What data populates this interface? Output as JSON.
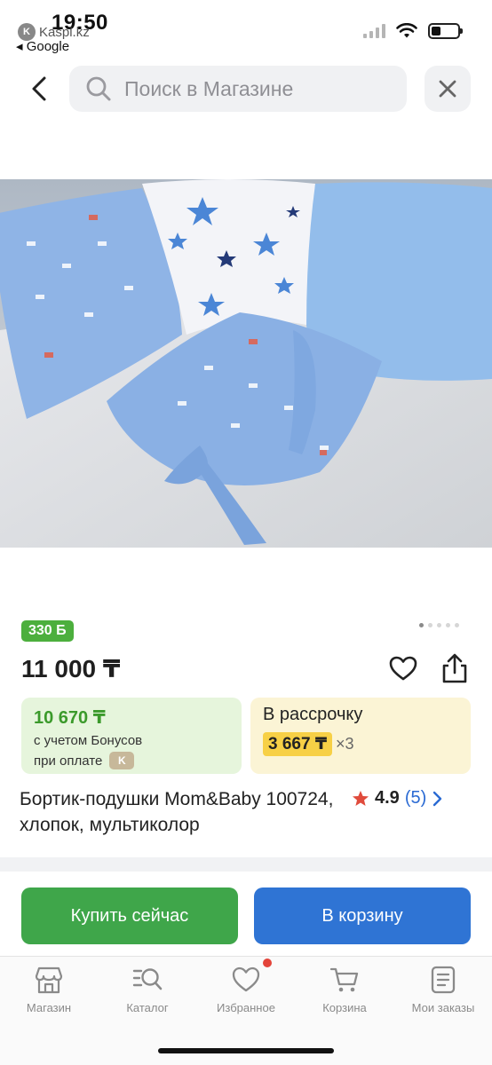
{
  "status_bar": {
    "time": "19:50",
    "source_app": "Kaspi.kz",
    "back_app": "◂ Google"
  },
  "header": {
    "search_placeholder": "Поиск в Магазине"
  },
  "product": {
    "bonus_badge": "330 Б",
    "image_index": 1,
    "image_count": 5,
    "price": "11 000 ₸",
    "bonus_card": {
      "price": "10 670 ₸",
      "line1": "с учетом Бонусов",
      "line2": "при оплате"
    },
    "installment": {
      "title": "В рассрочку",
      "amount": "3 667 ₸",
      "multiplier": "×3"
    },
    "title": "Бортик-подушки Mom&Baby 100724, хлопок, мультиколор",
    "rating": {
      "value": "4.9",
      "count": "(5)"
    }
  },
  "actions": {
    "buy_now": "Купить сейчас",
    "add_to_cart": "В корзину"
  },
  "tab_bar": {
    "items": [
      {
        "label": "Магазин",
        "icon": "store-icon"
      },
      {
        "label": "Каталог",
        "icon": "catalog-search-icon"
      },
      {
        "label": "Избранное",
        "icon": "heart-icon"
      },
      {
        "label": "Корзина",
        "icon": "cart-icon"
      },
      {
        "label": "Мои заказы",
        "icon": "orders-icon"
      }
    ]
  },
  "colors": {
    "buy_now": "#3fa64a",
    "cart": "#2f74d4",
    "bonus_green": "#3b9a2b",
    "installment_yellow": "#f7d046",
    "rating_star": "#e04b3c",
    "link_blue": "#2a6ad3"
  }
}
